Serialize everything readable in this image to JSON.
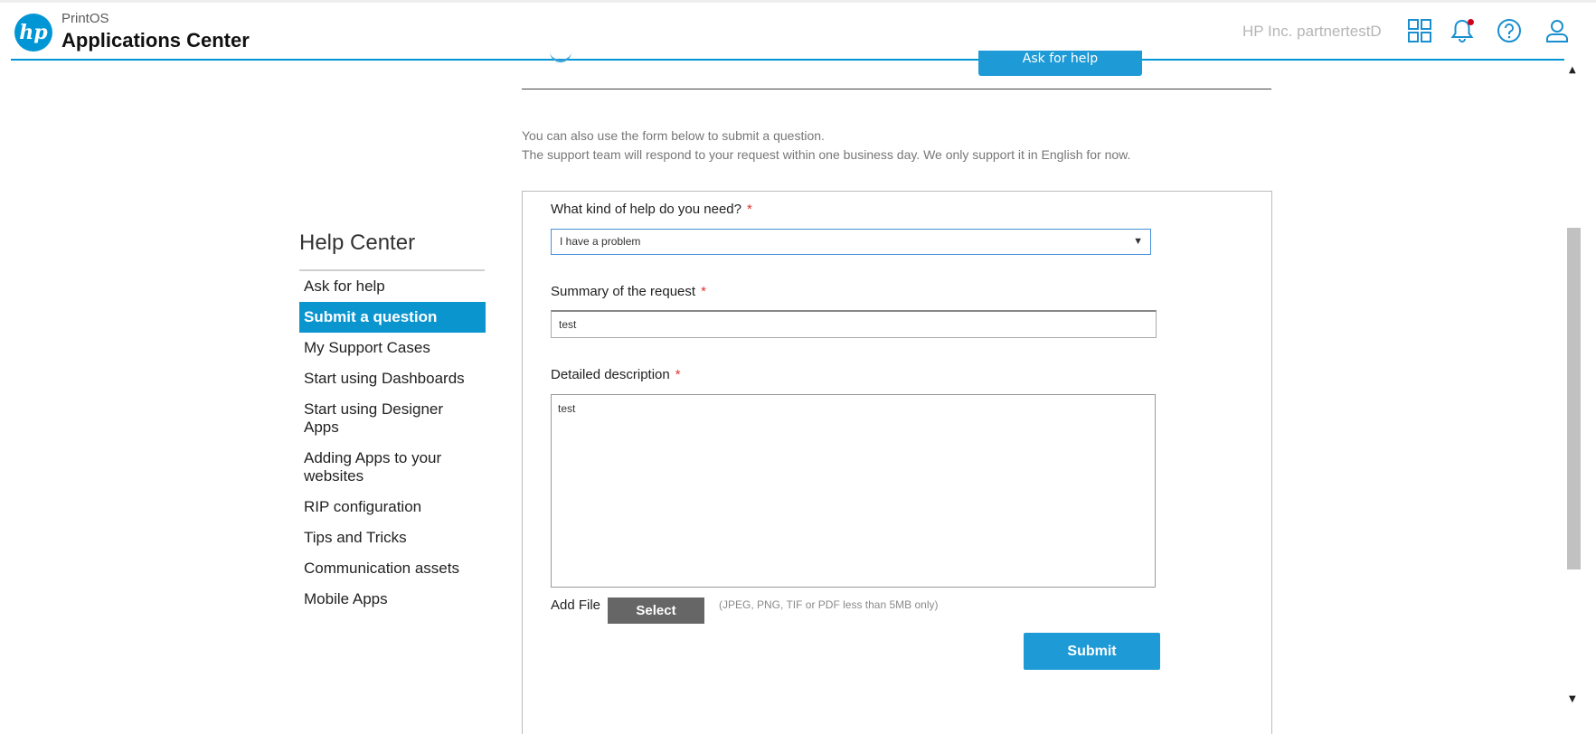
{
  "header": {
    "logo_text": "hp",
    "brand_sub": "PrintOS",
    "brand_main": "Applications Center",
    "user_name": "HP Inc. partnertestD",
    "icons": [
      "apps-grid-icon",
      "bell-icon",
      "help-icon",
      "user-icon"
    ],
    "accent_color": "#0096d6",
    "notification_dot_color": "#d0021b"
  },
  "top_section": {
    "ask_button_label": "Ask for help"
  },
  "info": {
    "line1": "You can also use the form below to submit a question.",
    "line2": "The support team will respond to your request within one business day. We only support it in English for now."
  },
  "sidebar": {
    "title": "Help Center",
    "items": [
      {
        "label": "Ask for help",
        "active": false
      },
      {
        "label": "Submit a question",
        "active": true
      },
      {
        "label": "My Support Cases",
        "active": false
      },
      {
        "label": "Start using Dashboards",
        "active": false
      },
      {
        "label": "Start using Designer Apps",
        "active": false
      },
      {
        "label": "Adding Apps to your websites",
        "active": false
      },
      {
        "label": "RIP configuration",
        "active": false
      },
      {
        "label": "Tips and Tricks",
        "active": false
      },
      {
        "label": "Communication assets",
        "active": false
      },
      {
        "label": "Mobile Apps",
        "active": false
      }
    ]
  },
  "form": {
    "help_type_label": "What kind of help do you need?",
    "help_type_value": "I have a problem",
    "summary_label": "Summary of the request",
    "summary_value": "test",
    "description_label": "Detailed description",
    "description_value": "test",
    "required_marker": "*",
    "add_file_label": "Add File",
    "select_button_label": "Select",
    "file_hint": "(JPEG, PNG, TIF or PDF less than 5MB only)",
    "submit_label": "Submit"
  }
}
